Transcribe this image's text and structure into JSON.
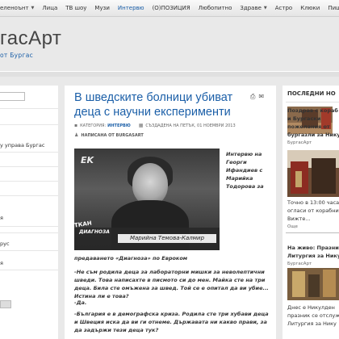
{
  "nav": {
    "items": [
      {
        "label": "еленоънт",
        "dropdown": true,
        "active": false
      },
      {
        "label": "Лица",
        "dropdown": false,
        "active": false
      },
      {
        "label": "ТВ шоу",
        "dropdown": false,
        "active": false
      },
      {
        "label": "Музи",
        "dropdown": false,
        "active": false
      },
      {
        "label": "Интервю",
        "dropdown": false,
        "active": true
      },
      {
        "label": "(О)ПОЗИЦИЯ",
        "dropdown": false,
        "active": false
      },
      {
        "label": "Любопитно",
        "dropdown": false,
        "active": false
      },
      {
        "label": "Здраве",
        "dropdown": true,
        "active": false
      },
      {
        "label": "Астро",
        "dropdown": false,
        "active": false
      },
      {
        "label": "Клюки",
        "dropdown": false,
        "active": false
      },
      {
        "label": "Пищ",
        "dropdown": false,
        "active": false
      }
    ]
  },
  "header": {
    "title": "гасАрт",
    "subtitle": "от Бургас"
  },
  "left": {
    "items": [
      "у управа Бургас",
      "я",
      "рус",
      "я"
    ]
  },
  "article": {
    "title": "В шведските болници убиват деца с научни експерименти",
    "category_label": "КАТЕГОРИЯ:",
    "category": "ИНТЕРВЮ",
    "created": "СЪЗДАДЕНА НА ПЕТЪК, 01 НОЕМВРИ 2013",
    "author": "НАПИСАНА ОТ BURGASART",
    "photo": {
      "logo": "EK",
      "show": "ДИАГНОЗА",
      "name_bar": "Марийна Темова-Калмир",
      "side": "ТКАН"
    },
    "side_caption": "Интервю на Георги Ифандиев с Марийка Тодорова за",
    "caption": "предаването «Диагноза» по Евроком",
    "paragraphs": [
      "-Не съм родила деца за лабораторни мишки за неволептични шведи. Това написахте в писмото си до мен. Майка сте на три деца. Била сте омъжена за швед. Той се е опитал да ви убие... Истина ли е това?",
      "-Да.",
      "-България е в демографска криза. Родила сте три хубави деца и Швеция иска да ви ги отнеме. Държавата ни какво прави, за да задържи тези деца тук?"
    ]
  },
  "right": {
    "heading": "ПОСЛЕДНИ НО",
    "item1_title": [
      "Поздрав с кораб",
      "и Бургаски",
      "пожелания от",
      "бургазли за Нику"
    ],
    "item1_sub": "БургасАрт",
    "item2_text": [
      "Точно в 13:00 часа",
      "огласи от корабни",
      "Вижте..."
    ],
    "item2_sub": "Още",
    "item3_title": [
      "На живо: Празни",
      "Литургия за Нику"
    ],
    "item3_sub": "БургасАрт",
    "item3_text": [
      "Днес е Никулден",
      "празник се отслужи",
      "Литургия за Нику"
    ]
  },
  "colors": {
    "accent": "#1b5fa8",
    "background": "#e9e9e9"
  }
}
